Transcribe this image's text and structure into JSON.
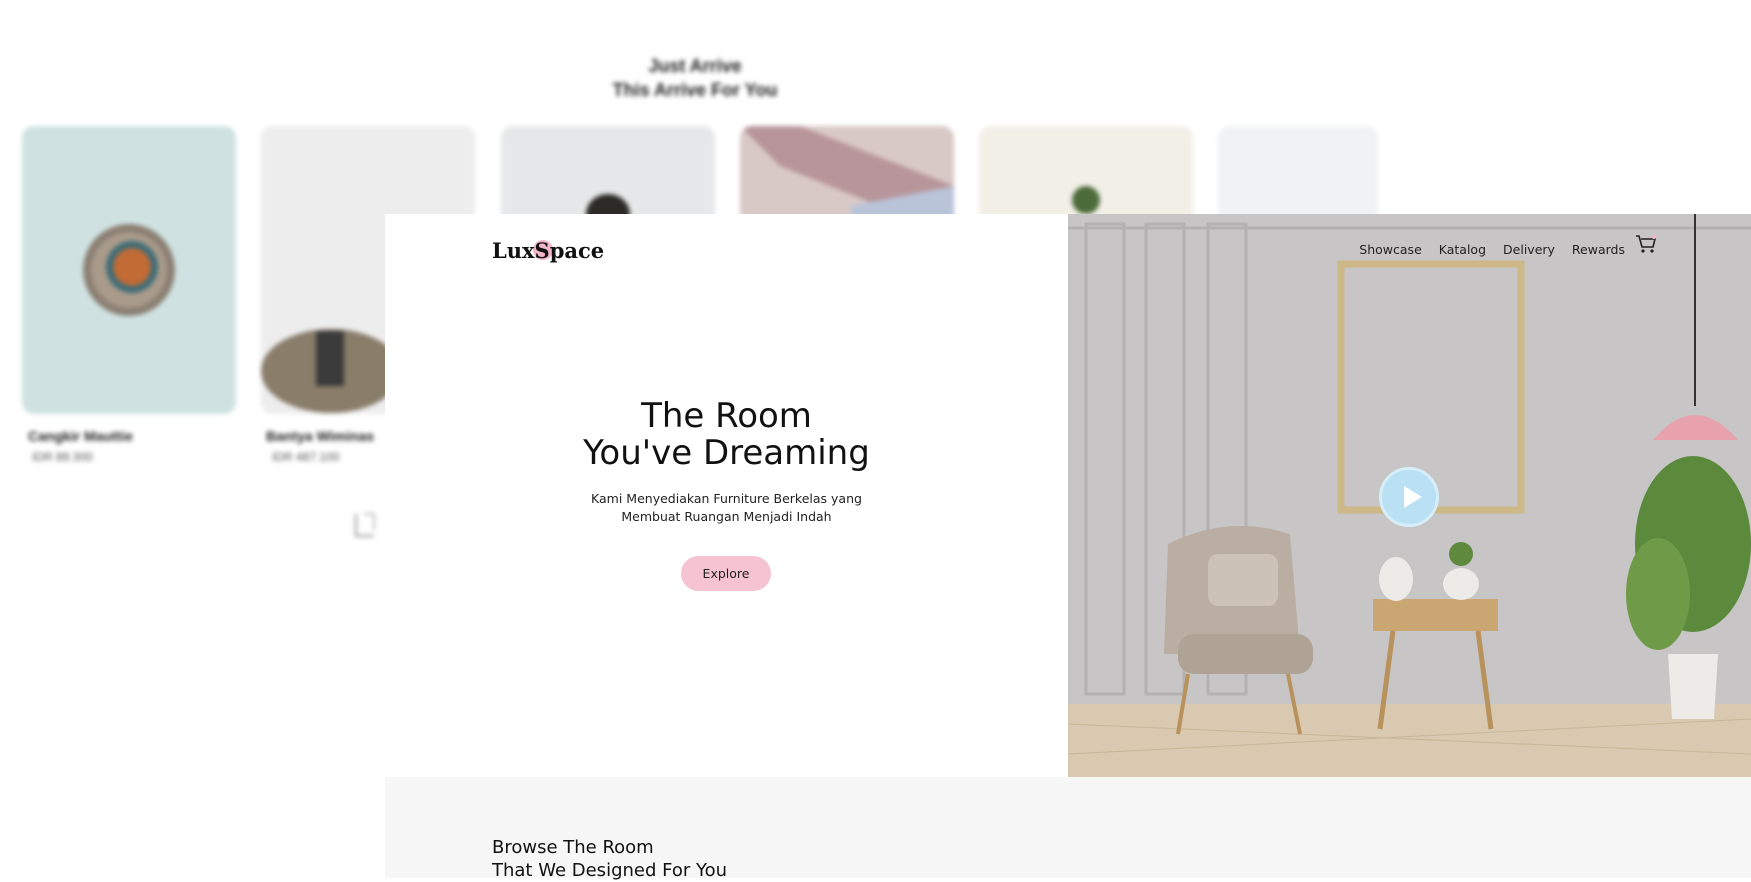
{
  "background": {
    "section_title_line1": "Just Arrive",
    "section_title_line2": "This Arrive For You",
    "products": [
      {
        "name": "Cangkir Mauttie",
        "price": "IDR 89.300"
      },
      {
        "name": "Bantya Wiminas",
        "price": "IDR 487.100"
      }
    ]
  },
  "header": {
    "logo": "LuxSpace",
    "nav": [
      "Showcase",
      "Katalog",
      "Delivery",
      "Rewards"
    ],
    "cart_icon": "cart-icon"
  },
  "hero": {
    "title_line1": "The Room",
    "title_line2": "You've Dreaming",
    "subtitle_line1": "Kami Menyediakan Furniture Berkelas yang",
    "subtitle_line2": "Membuat Ruangan Menjadi Indah",
    "cta": "Explore",
    "play_icon": "play-icon"
  },
  "browse": {
    "title_line1": "Browse The Room",
    "title_line2": "That We Designed For You"
  },
  "colors": {
    "accent_pink": "#f6c3d2",
    "play_blue": "#b9e0f3",
    "browse_bg": "#f7f7f7"
  }
}
